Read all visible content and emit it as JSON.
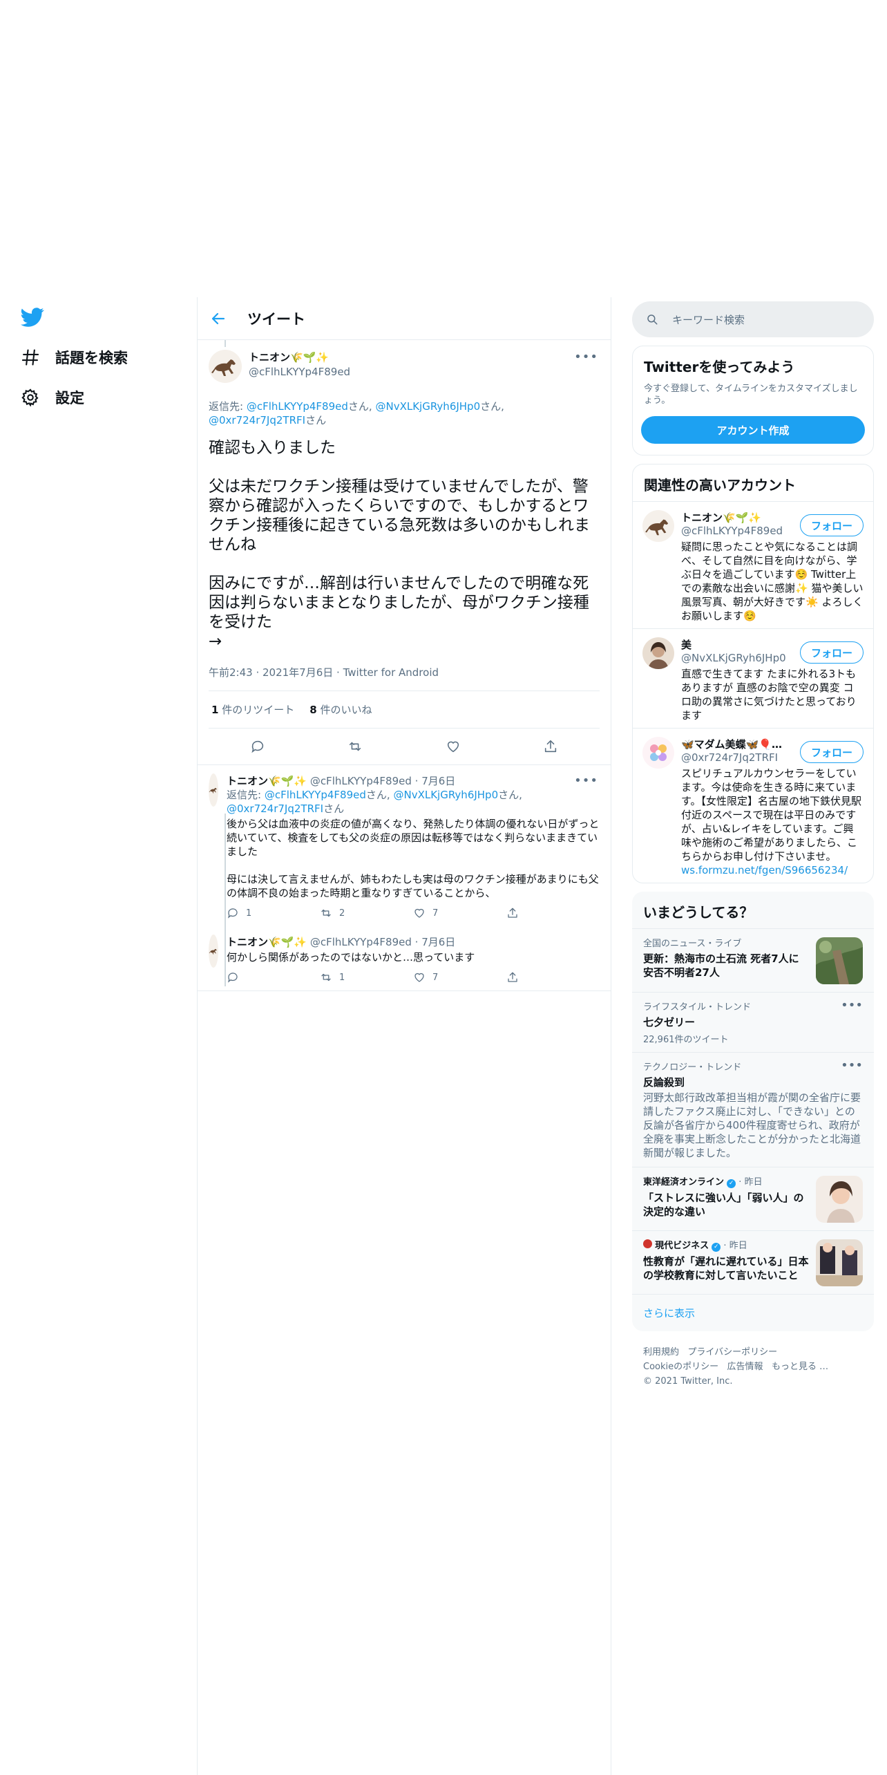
{
  "nav": {
    "items": [
      {
        "label": "話題を検索",
        "icon": "hashtag-icon"
      },
      {
        "label": "設定",
        "icon": "gear-icon"
      }
    ]
  },
  "header": {
    "title": "ツイート"
  },
  "main_tweet": {
    "author_name": "トニオン🌾🌱✨",
    "author_handle": "@cFlhLKYYp4F89ed",
    "reply_prefix": "返信先: ",
    "reply_mentions": [
      "@cFlhLKYYp4F89ed",
      "@NvXLKjGRyh6JHp0",
      "@0xr724r7Jq2TRFI"
    ],
    "reply_suffix": "さん",
    "text": "確認も入りました\n\n父は未だワクチン接種は受けていませんでしたが、警察から確認が入ったくらいですので、もしかするとワクチン接種後に起きている急死数は多いのかもしれませんね\n\n因みにですが…解剖は行いませんでしたので明確な死因は判らないままとなりましたが、母がワクチン接種を受けた\n→",
    "time": "午前2:43",
    "date": "2021年7月6日",
    "source": "Twitter for Android",
    "retweets": "1",
    "retweets_label": "件のリツイート",
    "likes": "8",
    "likes_label": "件のいいね"
  },
  "replies": [
    {
      "author_name": "トニオン🌾🌱✨",
      "author_handle": "@cFlhLKYYp4F89ed",
      "date": "7月6日",
      "reply_prefix": "返信先: ",
      "reply_mentions": [
        "@cFlhLKYYp4F89ed",
        "@NvXLKjGRyh6JHp0",
        "@0xr724r7Jq2TRFI"
      ],
      "reply_suffix": "さん",
      "text": "後から父は血液中の炎症の値が高くなり、発熱したり体調の優れない日がずっと続いていて、検査をしても父の炎症の原因は転移等ではなく判らないままきていました\n\n母には決して言えませんが、姉もわたしも実は母のワクチン接種があまりにも父の体調不良の始まった時期と重なりすぎていることから、",
      "replies": "1",
      "retweets": "2",
      "likes": "7"
    },
    {
      "author_name": "トニオン🌾🌱✨",
      "author_handle": "@cFlhLKYYp4F89ed",
      "date": "7月6日",
      "text": "何かしら関係があったのではないかと…思っています",
      "replies": "",
      "retweets": "1",
      "likes": "7"
    }
  ],
  "search": {
    "placeholder": "キーワード検索"
  },
  "signup": {
    "title": "Twitterを使ってみよう",
    "desc": "今すぐ登録して、タイムラインをカスタマイズしましょう。",
    "button": "アカウント作成"
  },
  "related": {
    "title": "関連性の高いアカウント",
    "follow_label": "フォロー",
    "accounts": [
      {
        "name": "トニオン🌾🌱✨",
        "handle": "@cFlhLKYYp4F89ed",
        "bio": "疑問に思ったことや気になることは調べ、そして自然に目を向けながら、学ぶ日々を過ごしています☺️ Twitter上での素敵な出会いに感謝✨ 猫や美しい風景写真、朝が大好きです☀️ よろしくお願いします☺️"
      },
      {
        "name": "美",
        "handle": "@NvXLKjGRyh6JHp0",
        "bio": "直感で生きてます たまに外れる3トもありますが 直感のお陰で空の異変 コロ助の異常さに気づけたと思っております"
      },
      {
        "name": "🦋マダム美蝶🦋🎈…",
        "handle": "@0xr724r7Jq2TRFI",
        "bio": "スピリチュアルカウンセラーをしています。今は使命を生きる時に来ています。【女性限定】名古屋の地下鉄伏見駅付近のスペースで現在は平日のみですが、占い&レイキをしています。ご興味や施術のご希望がありましたら、こちらからお申し付け下さいませ。",
        "bio_link": "ws.formzu.net/fgen/S96656234/"
      }
    ]
  },
  "trends": {
    "title": "いまどうしてる？",
    "items": [
      {
        "category": "全国のニュース・ライブ",
        "title": "更新：熱海市の土石流 死者7人に安否不明者27人",
        "thumb": "landslide-photo"
      },
      {
        "category": "ライフスタイル・トレンド",
        "title": "七夕ゼリー",
        "count": "22,961件のツイート"
      },
      {
        "category": "テクノロジー・トレンド",
        "title": "反論殺到",
        "desc": "河野太郎行政改革担当相が霞が関の全省庁に要請したファクス廃止に対し、「できない」との反論が各省庁から400件程度寄せられ、政府が全廃を事実上断念したことが分かったと北海道新聞が報じました。"
      },
      {
        "source": "東洋経済オンライン",
        "when": "昨日",
        "title": "「ストレスに強い人」「弱い人」の決定的な違い",
        "thumb": "woman-photo"
      },
      {
        "source": "現代ビジネス",
        "when": "昨日",
        "title": "性教育が「遅れに遅れている」日本の学校教育に対して言いたいこと",
        "thumb": "students-photo"
      }
    ],
    "show_more": "さらに表示"
  },
  "footer": {
    "links": [
      "利用規約",
      "プライバシーポリシー",
      "Cookieのポリシー",
      "広告情報",
      "もっと見る …"
    ],
    "copyright": "© 2021 Twitter, Inc."
  },
  "colors": {
    "accent": "#1da1f2",
    "link": "#1b95e0",
    "muted": "#5b7083",
    "border": "#e6ecf0"
  }
}
